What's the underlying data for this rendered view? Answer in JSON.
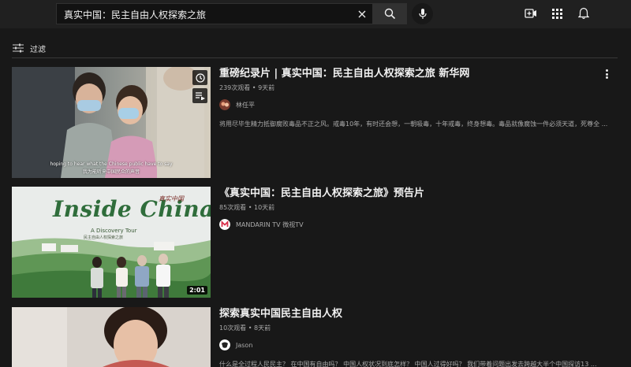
{
  "search": {
    "query": "真实中国：民主自由人权探索之旅"
  },
  "filter": {
    "label": "过滤"
  },
  "results": [
    {
      "title": "重磅纪录片 | 真实中国：民主自由人权探索之旅 新华网",
      "meta": "239次观看 • 9天前",
      "channel": "林任平",
      "description": "将用尽毕生精力抵御腐败毒品不正之风。戒毒10年，有时还会想，一朝吸毒，十年戒毒，终身想毒。毒品就像腐蚀一件必须天道，死尊全 ...",
      "subtitle_en": "hoping to hear what the Chinese public have to say",
      "subtitle_zh": "我为能听来中国民众的声音"
    },
    {
      "title": "《真实中国：民主自由人权探索之旅》预告片",
      "meta": "85次观看 • 10天前",
      "channel": "MANDARIN TV 微视TV",
      "duration": "2:01",
      "thumb_title": "Inside China",
      "thumb_subtitle": "A Discovery Tour",
      "thumb_subtitle_zh": "民主自由人权探索之旅",
      "thumb_seal": "真实中国"
    },
    {
      "title": "探索真实中国民主自由人权",
      "meta": "10次观看 • 8天前",
      "channel": "Jason",
      "description": "什么是全过程人民民主？ 在中国有自由吗？ 中国人权状况到底怎样？ 中国人过得好吗？ 我们带着问题出发去跨越大半个中国探访13 ..."
    }
  ],
  "colors": {
    "bg": "#181818",
    "topbar": "#202020",
    "text": "#f1f1f1",
    "muted": "#aaaaaa"
  }
}
